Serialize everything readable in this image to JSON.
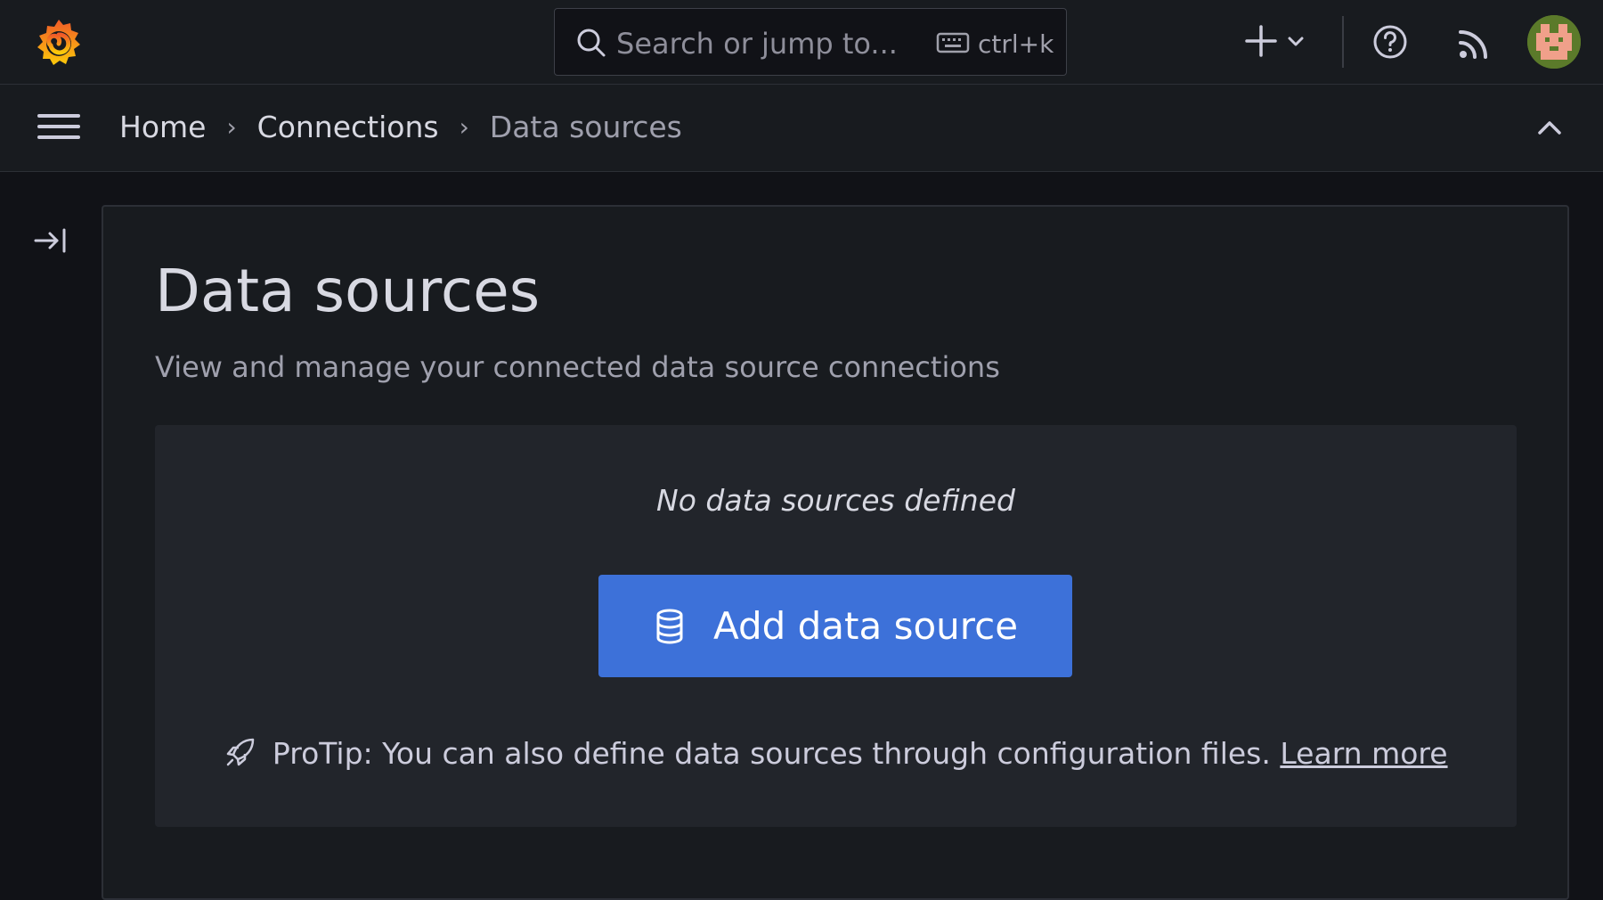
{
  "topbar": {
    "search_placeholder": "Search or jump to...",
    "search_shortcut": "ctrl+k"
  },
  "breadcrumb": {
    "items": [
      "Home",
      "Connections"
    ],
    "current": "Data sources"
  },
  "page": {
    "title": "Data sources",
    "subtitle": "View and manage your connected data source connections"
  },
  "empty_state": {
    "message": "No data sources defined",
    "add_button_label": "Add data source",
    "protip_text": "ProTip: You can also define data sources through configuration files.",
    "learn_more_label": "Learn more"
  },
  "icons": {
    "logo": "grafana-logo-icon",
    "search": "search-icon",
    "keyboard": "keyboard-icon",
    "new": "plus-icon",
    "help": "help-circle-icon",
    "news": "rss-icon",
    "menu": "hamburger-menu-icon",
    "collapse": "chevron-up-icon",
    "dock": "dock-menu-icon",
    "database": "database-icon",
    "rocket": "rocket-icon"
  },
  "colors": {
    "primary_button": "#3d71d9",
    "background": "#111217",
    "panel": "#181b1f"
  }
}
